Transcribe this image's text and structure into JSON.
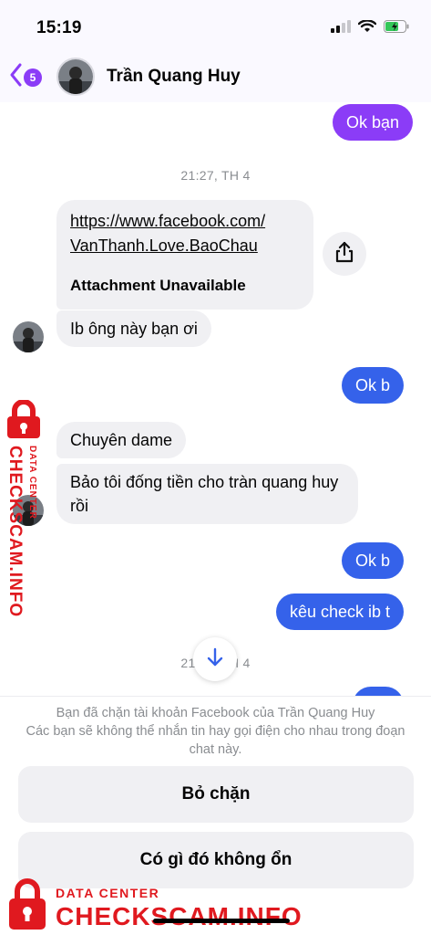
{
  "status_bar": {
    "time": "15:19"
  },
  "header": {
    "back_badge": "5",
    "contact_name": "Trần Quang Huy"
  },
  "messages": {
    "m1": "Ok bạn",
    "timestamp1": "21:27, TH 4",
    "link_url": "https://www.facebook.com/VanThanh.Love.BaoChau",
    "link_url_line1": "https://www.facebook.com/",
    "link_url_line2": "VanThanh.Love.BaoChau",
    "link_status": "Attachment Unavailable",
    "m2": "Ib ông này bạn ơi",
    "m3": "Ok b",
    "m4": "Chuyên dame",
    "m5": "Bảo tôi đống tiền cho tràn quang huy rồi",
    "m6": "Ok b",
    "m7": "kêu check ib t",
    "timestamp2": "21:27, TH 4"
  },
  "footer": {
    "blocked_line1": "Bạn đã chặn tài khoản Facebook của Trần Quang Huy",
    "blocked_line2": "Các bạn sẽ không thể nhắn tin hay gọi điện cho nhau trong đoạn chat này.",
    "unblock_label": "Bỏ chặn",
    "report_label": "Có gì đó không ổn"
  },
  "watermark": {
    "small": "DATA CENTER",
    "big": "CHECKSCAM.INFO"
  },
  "colors": {
    "accent_purple": "#8b3cf7",
    "accent_blue": "#3562ea",
    "incoming_bg": "#f0f0f3",
    "watermark_red": "#e0191f"
  }
}
